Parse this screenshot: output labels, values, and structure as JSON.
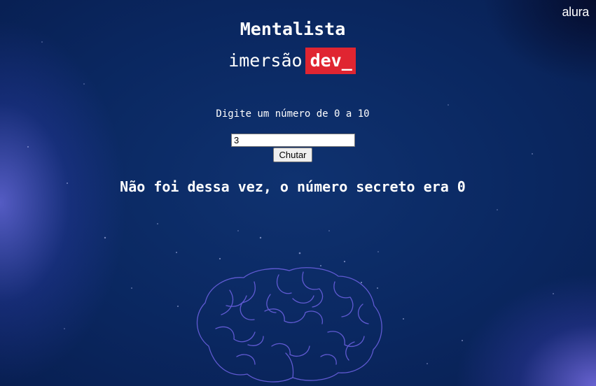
{
  "brand": {
    "name": "alura"
  },
  "header": {
    "title": "Mentalista",
    "logo_word": "imersão",
    "logo_badge": "dev_",
    "badge_color": "#e02531"
  },
  "game": {
    "prompt": "Digite um número de 0 a 10",
    "input_value": "3",
    "button_label": "Chutar",
    "result_message": "Não foi dessa vez, o número secreto era 0"
  },
  "theme": {
    "background": "#0a2760",
    "glow": "#6a6ae0",
    "illustration": "brain-icon"
  }
}
